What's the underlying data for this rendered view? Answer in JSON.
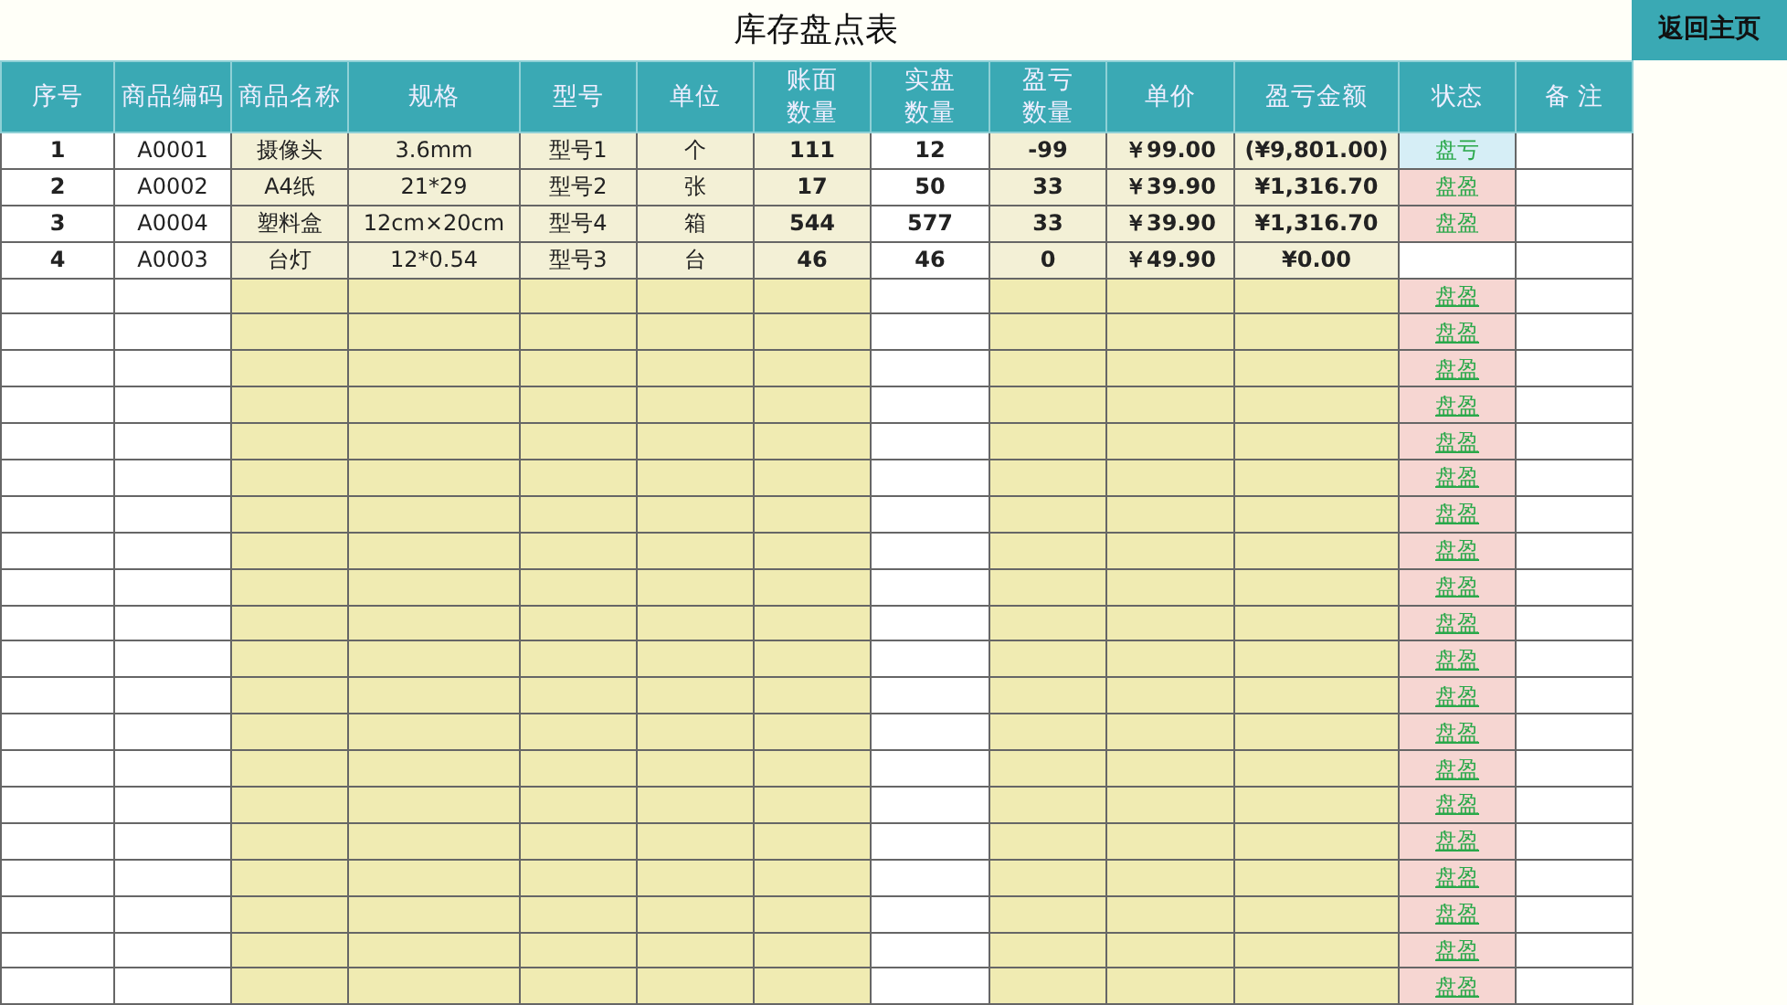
{
  "title": "库存盘点表",
  "home_button": "返回主页",
  "columns": [
    "序号",
    "商品编码",
    "商品名称",
    "规格",
    "型号",
    "单位",
    "账面数量",
    "实盘数量",
    "盈亏数量",
    "单价",
    "盈亏金额",
    "状态",
    "备 注"
  ],
  "rows": [
    {
      "cells": [
        "1",
        "A0001",
        "摄像头",
        "3.6mm",
        "型号1",
        "个",
        "111",
        "12",
        "-99",
        "￥99.00",
        "(¥9,801.00)"
      ],
      "status": {
        "kind": "loss",
        "text": "盘亏",
        "link": false
      }
    },
    {
      "cells": [
        "2",
        "A0002",
        "A4纸",
        "21*29",
        "型号2",
        "张",
        "17",
        "50",
        "33",
        "￥39.90",
        "¥1,316.70"
      ],
      "status": {
        "kind": "gain",
        "text": "盘盈",
        "link": false
      }
    },
    {
      "cells": [
        "3",
        "A0004",
        "塑料盒",
        "12cm×20cm",
        "型号4",
        "箱",
        "544",
        "577",
        "33",
        "￥39.90",
        "¥1,316.70"
      ],
      "status": {
        "kind": "gain",
        "text": "盘盈",
        "link": false
      }
    },
    {
      "cells": [
        "4",
        "A0003",
        "台灯",
        "12*0.54",
        "型号3",
        "台",
        "46",
        "46",
        "0",
        "￥49.90",
        "¥0.00"
      ],
      "status": {
        "kind": "none"
      }
    },
    {
      "status": {
        "kind": "gain",
        "text": "盘盈",
        "link": true
      }
    },
    {
      "status": {
        "kind": "gain",
        "text": "盘盈",
        "link": true
      }
    },
    {
      "status": {
        "kind": "gain",
        "text": "盘盈",
        "link": true
      }
    },
    {
      "status": {
        "kind": "gain",
        "text": "盘盈",
        "link": true
      }
    },
    {
      "status": {
        "kind": "gain",
        "text": "盘盈",
        "link": true
      }
    },
    {
      "status": {
        "kind": "gain",
        "text": "盘盈",
        "link": true
      }
    },
    {
      "status": {
        "kind": "gain",
        "text": "盘盈",
        "link": true
      }
    },
    {
      "status": {
        "kind": "gain",
        "text": "盘盈",
        "link": true
      }
    },
    {
      "status": {
        "kind": "gain",
        "text": "盘盈",
        "link": true
      }
    },
    {
      "status": {
        "kind": "gain",
        "text": "盘盈",
        "link": true
      }
    },
    {
      "status": {
        "kind": "gain",
        "text": "盘盈",
        "link": true
      }
    },
    {
      "status": {
        "kind": "gain",
        "text": "盘盈",
        "link": true
      }
    },
    {
      "status": {
        "kind": "gain",
        "text": "盘盈",
        "link": true
      }
    },
    {
      "status": {
        "kind": "gain",
        "text": "盘盈",
        "link": true
      }
    },
    {
      "status": {
        "kind": "gain",
        "text": "盘盈",
        "link": true
      }
    },
    {
      "status": {
        "kind": "gain",
        "text": "盘盈",
        "link": true
      }
    },
    {
      "status": {
        "kind": "gain",
        "text": "盘盈",
        "link": true
      }
    },
    {
      "status": {
        "kind": "gain",
        "text": "盘盈",
        "link": true
      }
    },
    {
      "status": {
        "kind": "gain",
        "text": "盘盈",
        "link": true
      }
    },
    {
      "status": {
        "kind": "gain",
        "text": "盘盈",
        "link": true
      }
    }
  ]
}
